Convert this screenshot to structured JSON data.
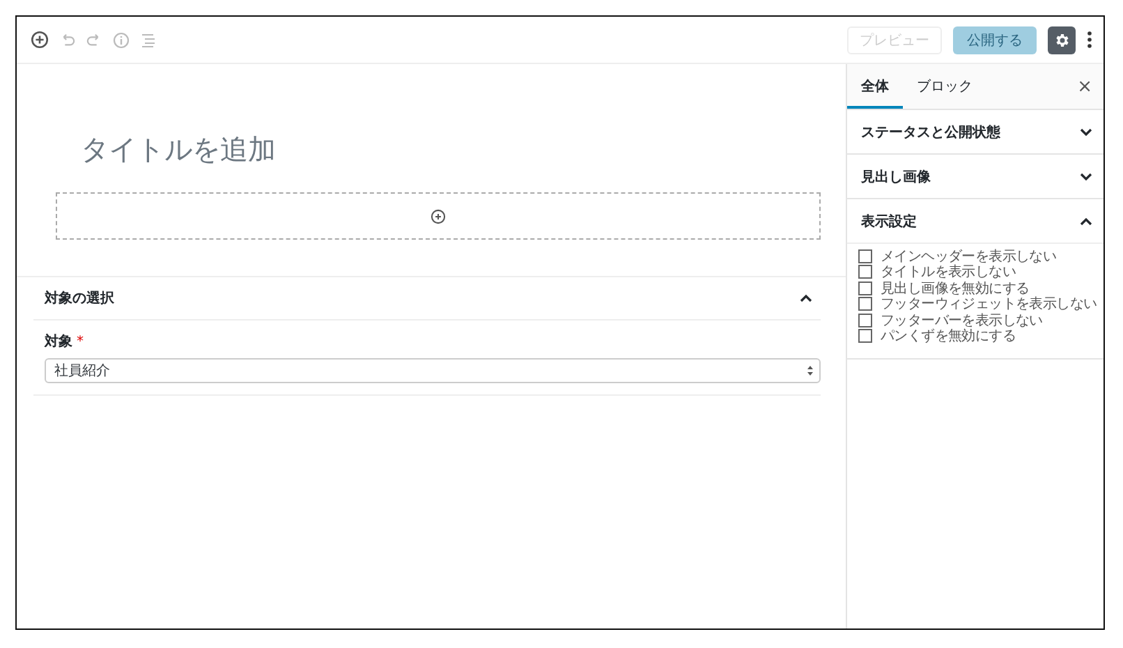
{
  "toolbar": {
    "preview": "プレビュー",
    "publish": "公開する",
    "publish_disabled": true,
    "settings_active": true
  },
  "editor": {
    "title_placeholder": "タイトルを追加"
  },
  "metabox": {
    "title": "対象の選択",
    "expanded": true,
    "field_label": "対象",
    "required_mark": "*",
    "select_value": "社員紹介"
  },
  "sidebar": {
    "tabs": [
      {
        "label": "全体",
        "selected": true
      },
      {
        "label": "ブロック",
        "selected": false
      }
    ],
    "close": "×",
    "panels": [
      {
        "title": "ステータスと公開状態",
        "expanded": false
      },
      {
        "title": "見出し画像",
        "expanded": false
      },
      {
        "title": "表示設定",
        "expanded": true,
        "options": [
          {
            "label": "メインヘッダーを表示しない",
            "checked": false
          },
          {
            "label": "タイトルを表示しない",
            "checked": false
          },
          {
            "label": "見出し画像を無効にする",
            "checked": false
          },
          {
            "label": "フッターウィジェットを表示しない",
            "checked": false
          },
          {
            "label": "フッターバーを表示しない",
            "checked": false
          },
          {
            "label": "パンくずを無効にする",
            "checked": false
          }
        ]
      }
    ]
  }
}
